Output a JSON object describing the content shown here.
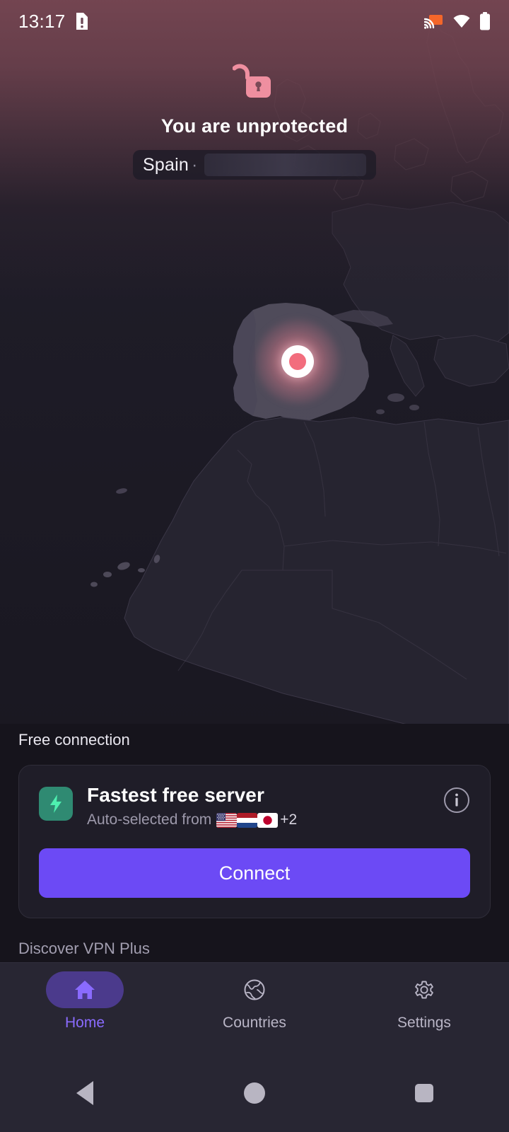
{
  "app": {
    "accent_purple": "#6c4af5",
    "accent_pink": "#f08a9c",
    "accent_green": "#2f8a72",
    "background": "#16141c"
  },
  "statusbar": {
    "time": "13:17",
    "icons": [
      {
        "name": "sim-alert-icon",
        "label": "SIM card alert"
      },
      {
        "name": "cast-icon",
        "label": "Screen cast active"
      },
      {
        "name": "wifi-icon",
        "label": "Wi-Fi connected"
      },
      {
        "name": "battery-icon",
        "label": "Battery full"
      }
    ]
  },
  "hero": {
    "lock_icon": "unlocked-padlock-icon",
    "status_title": "You are unprotected",
    "location_chip": {
      "country": "Spain",
      "separator": "·",
      "ip_value": "",
      "ip_loading": true
    },
    "marker": {
      "name": "current-location-marker",
      "country": "Spain"
    }
  },
  "main": {
    "section_label": "Free connection",
    "server_card": {
      "badge_icon": "lightning-bolt-icon",
      "title": "Fastest free server",
      "subtitle_prefix": "Auto-selected from",
      "flags": [
        {
          "code": "US",
          "name": "flag-united-states"
        },
        {
          "code": "NL",
          "name": "flag-netherlands"
        },
        {
          "code": "JP",
          "name": "flag-japan"
        }
      ],
      "extra_count": "+2",
      "info_icon": "info-icon",
      "connect_label": "Connect"
    },
    "discover_label": "Discover VPN Plus"
  },
  "bottom_nav": {
    "items": [
      {
        "label": "Home",
        "icon": "home-icon",
        "active": true
      },
      {
        "label": "Countries",
        "icon": "globe-icon",
        "active": false
      },
      {
        "label": "Settings",
        "icon": "gear-icon",
        "active": false
      }
    ]
  },
  "system_nav": {
    "back": "back-button",
    "home": "home-button",
    "recents": "recents-button"
  }
}
